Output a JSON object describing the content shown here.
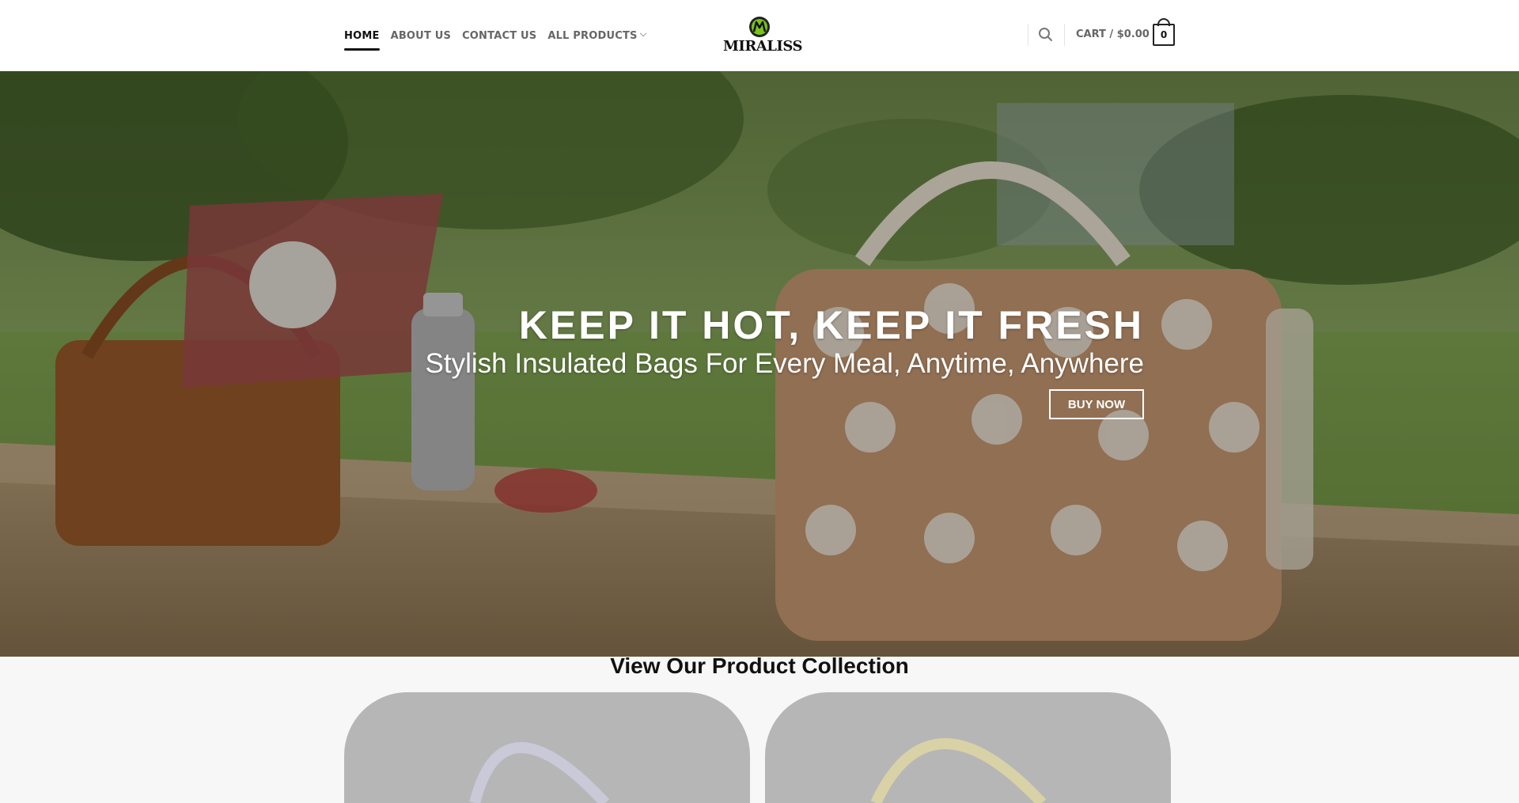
{
  "nav": {
    "items": [
      {
        "label": "HOME",
        "active": true
      },
      {
        "label": "ABOUT US",
        "active": false
      },
      {
        "label": "CONTACT US",
        "active": false
      },
      {
        "label": "ALL PRODUCTS",
        "active": false,
        "dropdown": true
      }
    ]
  },
  "logo": {
    "text": "MIRALISS",
    "accent": "#7bc21a"
  },
  "header": {
    "search_icon": "search-icon",
    "cart_label": "CART / $0.00",
    "cart_count": "0"
  },
  "hero": {
    "title": "KEEP IT HOT, KEEP IT FRESH",
    "subtitle": "Stylish Insulated Bags For Every Meal, Anytime, Anywhere",
    "button_label": "BUY NOW"
  },
  "collection": {
    "title": "View Our Product Collection",
    "cards": [
      {
        "icon": "bag-image"
      },
      {
        "icon": "bag-image"
      }
    ]
  }
}
